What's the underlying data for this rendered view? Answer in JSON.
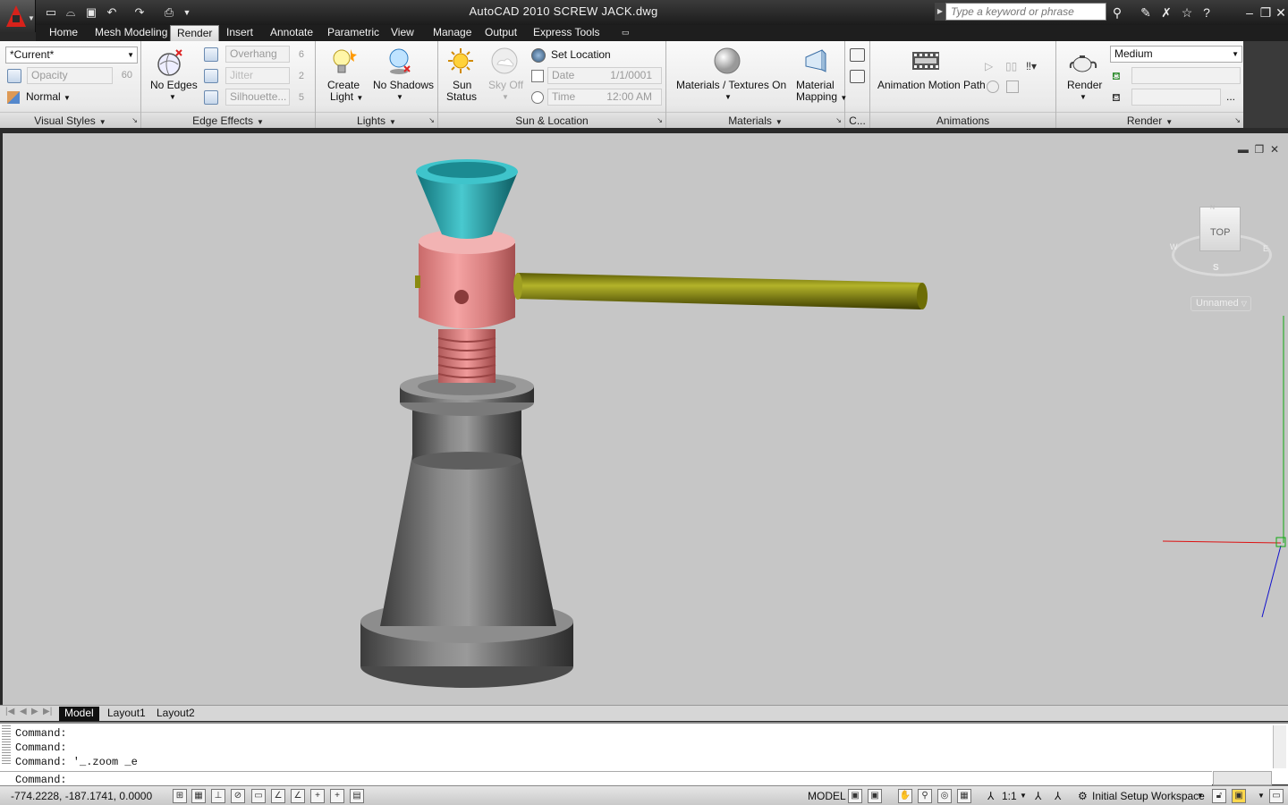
{
  "window": {
    "title": "AutoCAD 2010    SCREW JACK.dwg"
  },
  "search": {
    "placeholder": "Type a keyword or phrase"
  },
  "tabs": [
    "Home",
    "Mesh Modeling",
    "Render",
    "Insert",
    "Annotate",
    "Parametric",
    "View",
    "Manage",
    "Output",
    "Express Tools"
  ],
  "active_tab": "Render",
  "ribbon": {
    "visual_styles": {
      "style": "*Current*",
      "opacity_label": "Opacity",
      "opacity_value": "60",
      "face": "Normal",
      "title": "Visual Styles"
    },
    "edge_effects": {
      "no_edges": "No Edges",
      "overhang": "Overhang",
      "overhang_value": "6",
      "jitter": "Jitter",
      "jitter_value": "2",
      "silhouette": "Silhouette...",
      "silhouette_value": "5",
      "title": "Edge Effects"
    },
    "lights": {
      "create_light_1": "Create",
      "create_light_2": "Light",
      "no_shadows": "No Shadows",
      "title": "Lights"
    },
    "sun": {
      "sun_status_1": "Sun",
      "sun_status_2": "Status",
      "sky_off": "Sky Off",
      "set_location": "Set Location",
      "date_label": "Date",
      "date_value": "1/1/0001",
      "time_label": "Time",
      "time_value": "12:00 AM",
      "title": "Sun & Location"
    },
    "materials": {
      "materials_textures": "Materials / Textures On",
      "mapping_1": "Material",
      "mapping_2": "Mapping",
      "title": "Materials"
    },
    "camera": {
      "title": "C..."
    },
    "animations": {
      "motion_path": "Animation Motion Path",
      "title": "Animations"
    },
    "render": {
      "render_label": "Render",
      "quality": "Medium",
      "more": "...",
      "title": "Render"
    }
  },
  "viewcube": {
    "face": "TOP",
    "north": "N",
    "south": "S",
    "east": "E",
    "west": "W",
    "ucs": "Unnamed"
  },
  "layout_tabs": [
    "Model",
    "Layout1",
    "Layout2"
  ],
  "command": {
    "lines": [
      "Command:",
      "Command:",
      "Command: '_.zoom _e"
    ],
    "prompt": "Command:"
  },
  "status": {
    "coords": "-774.2228, -187.1741, 0.0000",
    "model": "MODEL",
    "scale": "1:1",
    "workspace": "Initial Setup Workspace"
  },
  "colors": {
    "cup": "#2aa9b0",
    "nut": "#e48b8b",
    "handle": "#8a8a10",
    "body": "#6e6e6e",
    "viewport": "#c6c6c6"
  }
}
